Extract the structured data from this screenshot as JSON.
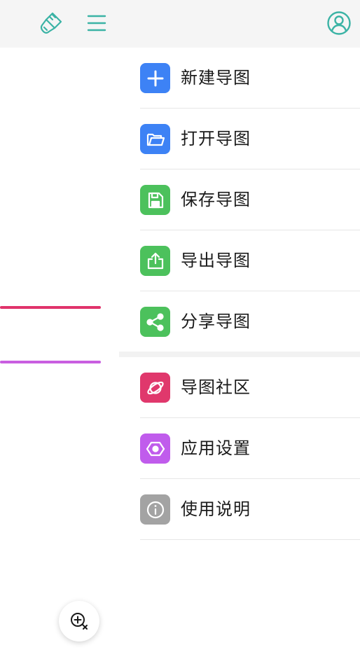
{
  "colors": {
    "topbar_bg": "#f5f5f5",
    "accent": "#3bb3a5",
    "blue": "#3d82f5",
    "green": "#4cc15c",
    "pink": "#e0386c",
    "purple": "#c05cec",
    "gray": "#a3a3a3",
    "line_pink": "#e0336b",
    "line_purple": "#c95ee0"
  },
  "topbar": {
    "left_icons": [
      "brush-icon",
      "menu-icon"
    ],
    "right_icon": "user-avatar-icon"
  },
  "menu": {
    "groups": [
      {
        "items": [
          {
            "label": "新建导图",
            "icon": "plus-icon",
            "color": "#3d82f5"
          },
          {
            "label": "打开导图",
            "icon": "folder-open-icon",
            "color": "#3d82f5"
          },
          {
            "label": "保存导图",
            "icon": "save-icon",
            "color": "#4cc15c"
          },
          {
            "label": "导出导图",
            "icon": "export-icon",
            "color": "#4cc15c"
          },
          {
            "label": "分享导图",
            "icon": "share-icon",
            "color": "#4cc15c"
          }
        ]
      },
      {
        "items": [
          {
            "label": "导图社区",
            "icon": "planet-icon",
            "color": "#e0386c"
          },
          {
            "label": "应用设置",
            "icon": "hexagon-settings-icon",
            "color": "#c05cec"
          },
          {
            "label": "使用说明",
            "icon": "info-icon",
            "color": "#a3a3a3"
          }
        ]
      }
    ]
  },
  "fab": {
    "icon": "zoom-in-icon"
  }
}
